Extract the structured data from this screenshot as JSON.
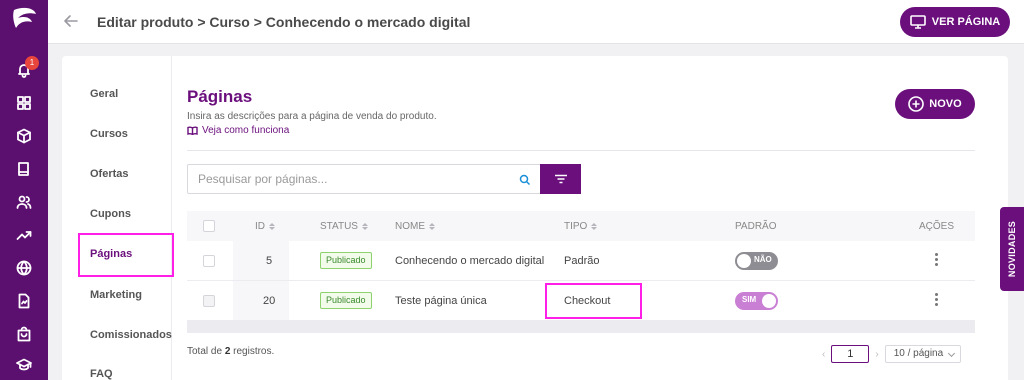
{
  "rail": {
    "notification_count": "1",
    "icons": [
      "logo-icon",
      "bell-icon",
      "grid-icon",
      "box-icon",
      "book-icon",
      "users-icon",
      "trending-icon",
      "globe-icon",
      "document-icon",
      "bag-icon",
      "graduation-icon"
    ]
  },
  "header": {
    "breadcrumb": "Editar produto > Curso > Conhecendo o mercado digital",
    "ver_pagina_label": "VER PÁGINA"
  },
  "menu": {
    "items": [
      "Geral",
      "Cursos",
      "Ofertas",
      "Cupons",
      "Páginas",
      "Marketing",
      "Comissionados",
      "FAQ"
    ],
    "selected": "Páginas"
  },
  "pages": {
    "title": "Páginas",
    "subtitle": "Insira as descrições para a página de venda do produto.",
    "howto_link": "Veja como funciona",
    "new_button": "NOVO",
    "search_placeholder": "Pesquisar por páginas..."
  },
  "table": {
    "columns": {
      "id": "ID",
      "status": "STATUS",
      "nome": "NOME",
      "tipo": "TIPO",
      "padrao": "PADRÃO",
      "acoes": "AÇÕES"
    },
    "rows": [
      {
        "id": "5",
        "status": "Publicado",
        "nome": "Conhecendo o mercado digital",
        "tipo": "Padrão",
        "padrao": "NÃO"
      },
      {
        "id": "20",
        "status": "Publicado",
        "nome": "Teste página única",
        "tipo": "Checkout",
        "padrao": "SIM"
      }
    ]
  },
  "footer": {
    "total_prefix": "Total de ",
    "total_count": "2",
    "total_suffix": " registros.",
    "current_page": "1",
    "page_size": "10 / página"
  },
  "sidebar_tab": "NOVIDADES",
  "colors": {
    "brand": "#6b0f7d",
    "rail": "#5b0f6e",
    "highlight": "#ff1fe6",
    "success": "#3a8a2e"
  }
}
